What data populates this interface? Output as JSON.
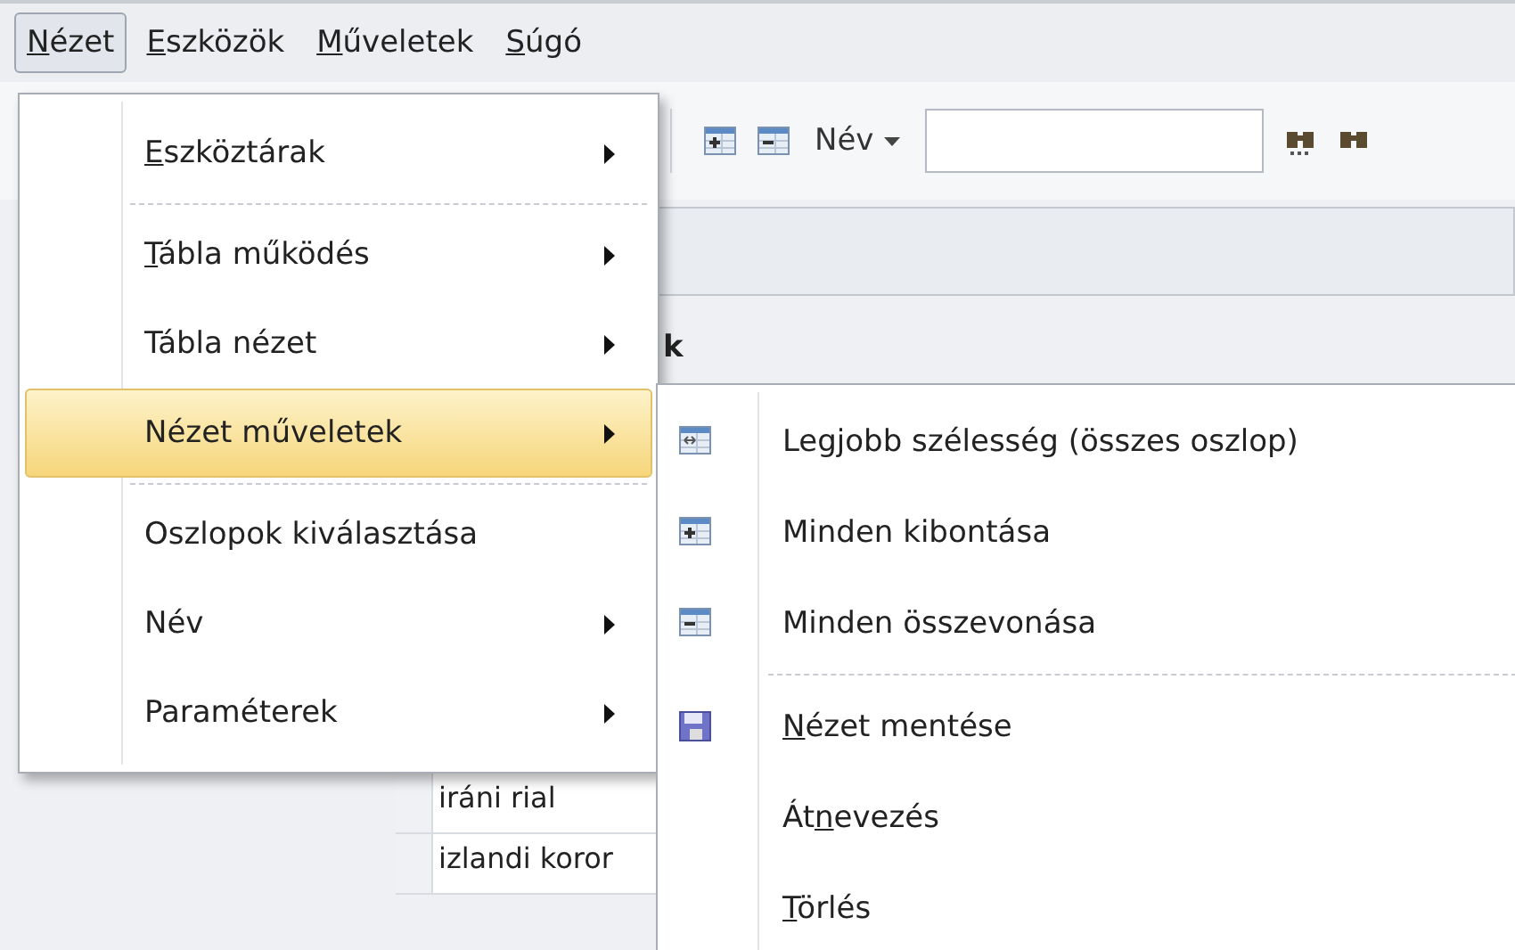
{
  "menu_bar": [
    {
      "key": "N",
      "post": "ézet",
      "selected": true
    },
    {
      "key": "E",
      "post": "szközök",
      "selected": false
    },
    {
      "key": "M",
      "post": "űveletek",
      "selected": false
    },
    {
      "key": "S",
      "post": "úgó",
      "selected": false
    }
  ],
  "toolbar": {
    "name_dropdown": "Név"
  },
  "table": {
    "header": "k",
    "rows": [
      "iráni rial",
      "izlandi koror"
    ]
  },
  "menu": [
    {
      "kind": "item",
      "key": "E",
      "post": "szköztárak",
      "submenu": true,
      "selected": false
    },
    {
      "kind": "separator"
    },
    {
      "kind": "item",
      "key": "T",
      "post": "ábla működés",
      "submenu": true,
      "selected": false
    },
    {
      "kind": "item",
      "label": "Tábla nézet",
      "submenu": true,
      "selected": false
    },
    {
      "kind": "item",
      "label": "Nézet műveletek",
      "submenu": true,
      "selected": true
    },
    {
      "kind": "separator"
    },
    {
      "kind": "item",
      "label": "Oszlopok kiválasztása",
      "submenu": false,
      "selected": false
    },
    {
      "kind": "item",
      "label": "Név",
      "submenu": true,
      "selected": false
    },
    {
      "kind": "item",
      "label": "Paraméterek",
      "submenu": true,
      "selected": false
    }
  ],
  "submenu": [
    {
      "kind": "fit",
      "label": "Legjobb szélesség (összes oszlop)"
    },
    {
      "kind": "expand",
      "label": "Minden kibontása"
    },
    {
      "kind": "collapse",
      "label": "Minden összevonása"
    },
    {
      "kind": "separator"
    },
    {
      "kind": "save",
      "key": "N",
      "post": "ézet mentése"
    },
    {
      "kind": "plain",
      "pre": "Át",
      "key": "n",
      "post": "evezés"
    },
    {
      "kind": "plain",
      "key": "T",
      "post": "örlés"
    }
  ]
}
